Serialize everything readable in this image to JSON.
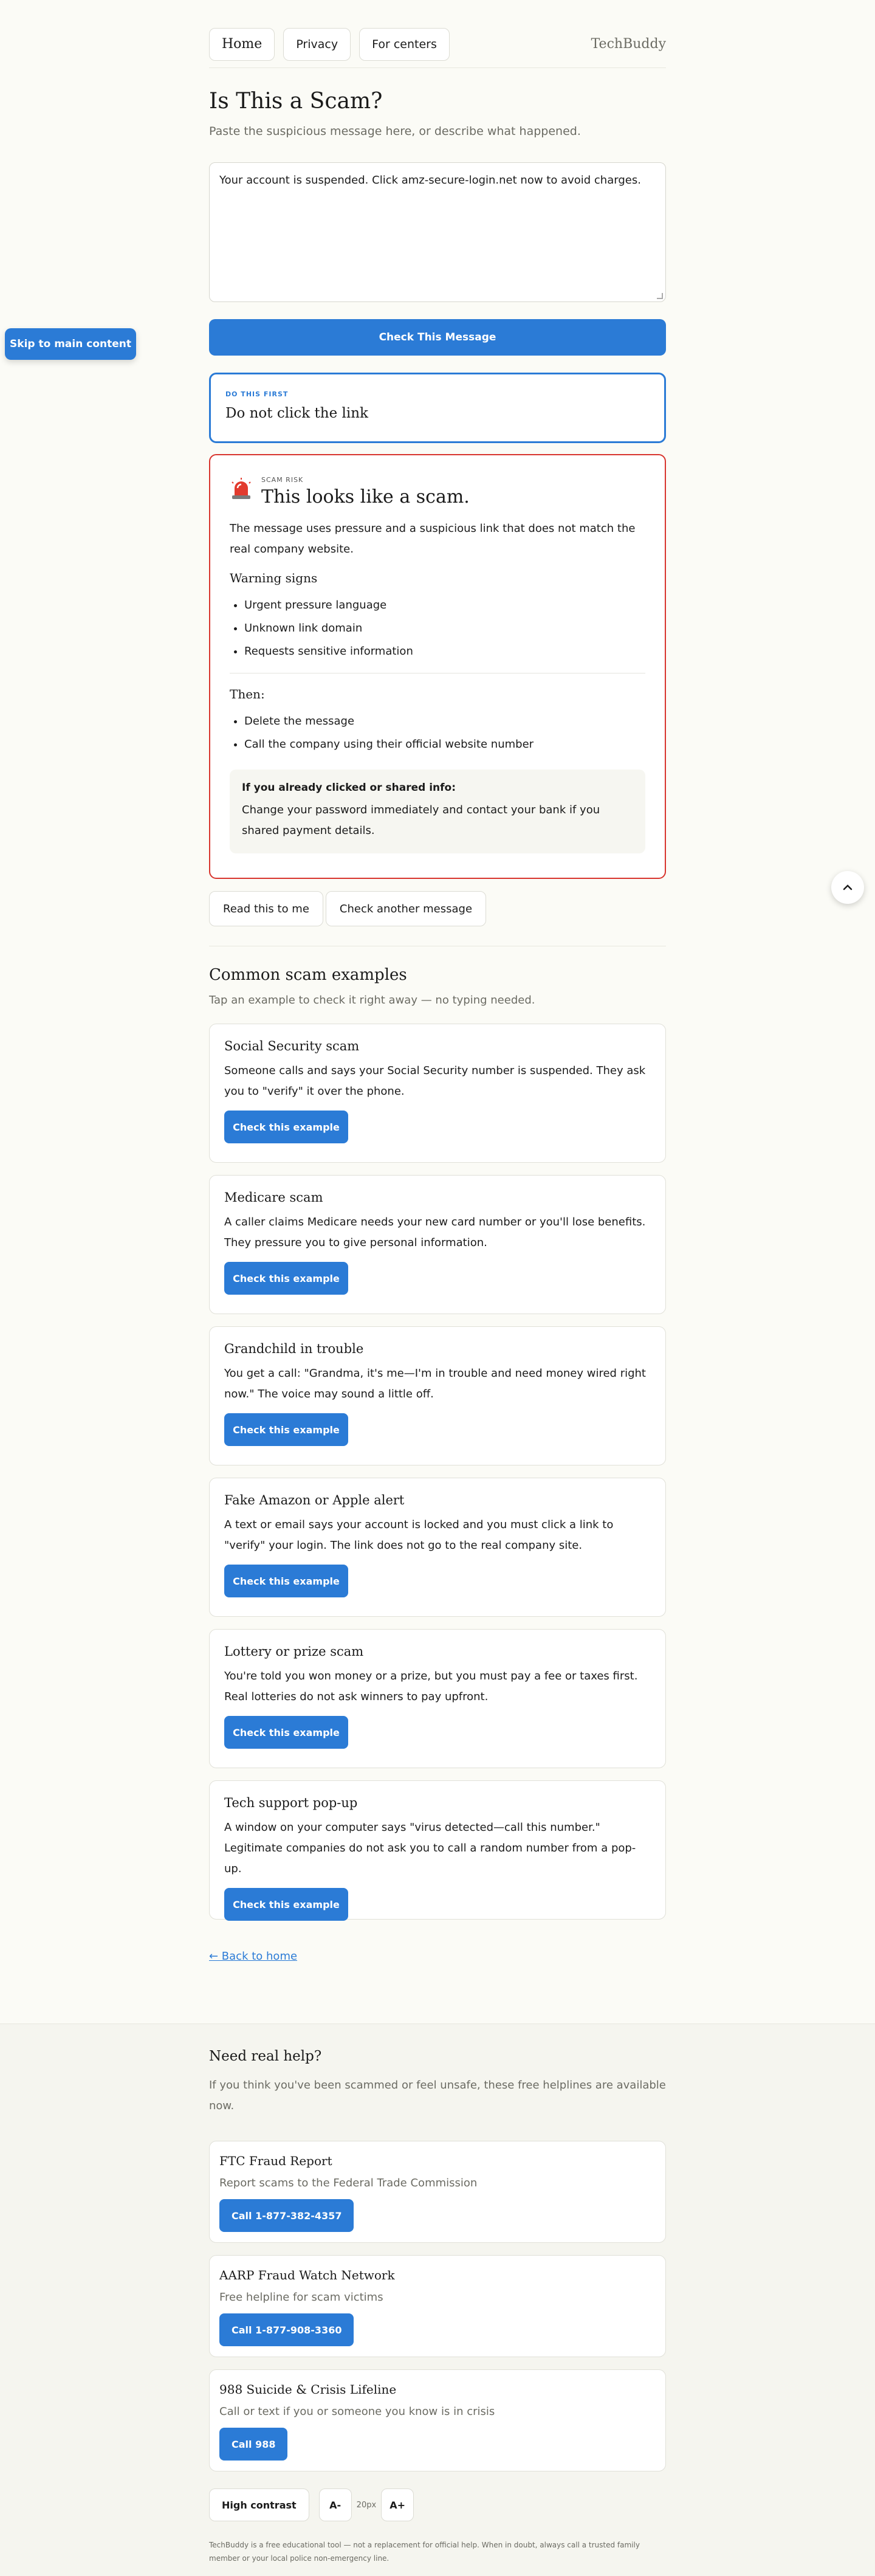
{
  "nav": {
    "home": "Home",
    "privacy": "Privacy",
    "centers": "For centers",
    "brand": "TechBuddy"
  },
  "skip_link": "Skip to main content",
  "page": {
    "title": "Is This a Scam?",
    "subtitle": "Paste the suspicious message here, or describe what happened.",
    "message_value": "Your account is suspended. Click amz-secure-login.net now to avoid charges.",
    "check_button": "Check This Message"
  },
  "first": {
    "tag": "DO THIS FIRST",
    "text": "Do not click the link"
  },
  "result": {
    "tag": "SCAM RISK",
    "title": "This looks like a scam.",
    "description": "The message uses pressure and a suspicious link that does not match the real company website.",
    "signs_heading": "Warning signs",
    "signs": [
      "Urgent pressure language",
      "Unknown link domain",
      "Requests sensitive information"
    ],
    "then_heading": "Then:",
    "then_steps": [
      "Delete the message",
      "Call the company using their official website number"
    ],
    "clicked_title": "If you already clicked or shared info:",
    "clicked_text": "Change your password immediately and contact your bank if you shared payment details.",
    "colors": {
      "danger": "#d8352e",
      "accent": "#2b7bd6"
    }
  },
  "actions": {
    "read": "Read this to me",
    "another": "Check another message"
  },
  "examples": {
    "heading": "Common scam examples",
    "subtitle": "Tap an example to check it right away — no typing needed.",
    "button": "Check this example",
    "items": [
      {
        "title": "Social Security scam",
        "desc": "Someone calls and says your Social Security number is suspended. They ask you to \"verify\" it over the phone."
      },
      {
        "title": "Medicare scam",
        "desc": "A caller claims Medicare needs your new card number or you'll lose benefits. They pressure you to give personal information."
      },
      {
        "title": "Grandchild in trouble",
        "desc": "You get a call: \"Grandma, it's me—I'm in trouble and need money wired right now.\" The voice may sound a little off."
      },
      {
        "title": "Fake Amazon or Apple alert",
        "desc": "A text or email says your account is locked and you must click a link to \"verify\" your login. The link does not go to the real company site."
      },
      {
        "title": "Lottery or prize scam",
        "desc": "You're told you won money or a prize, but you must pay a fee or taxes first. Real lotteries do not ask winners to pay upfront."
      },
      {
        "title": "Tech support pop-up",
        "desc": "A window on your computer says \"virus detected—call this number.\" Legitimate companies do not ask you to call a random number from a pop-up."
      }
    ]
  },
  "back_link": "← Back to home",
  "footer": {
    "heading": "Need real help?",
    "lead": "If you think you've been scammed or feel unsafe, these free helplines are available now.",
    "helplines": [
      {
        "title": "FTC Fraud Report",
        "desc": "Report scams to the Federal Trade Commission",
        "button": "Call 1-877-382-4357"
      },
      {
        "title": "AARP Fraud Watch Network",
        "desc": "Free helpline for scam victims",
        "button": "Call 1-877-908-3360"
      },
      {
        "title": "988 Suicide & Crisis Lifeline",
        "desc": "Call or text if you or someone you know is in crisis",
        "button": "Call 988"
      }
    ],
    "contrast": "High contrast",
    "smaller": "A-",
    "size": "20px",
    "larger": "A+",
    "disclaimer": "TechBuddy is a free educational tool — not a replacement for official help. When in doubt, always call a trusted family member or your local police non-emergency line."
  }
}
